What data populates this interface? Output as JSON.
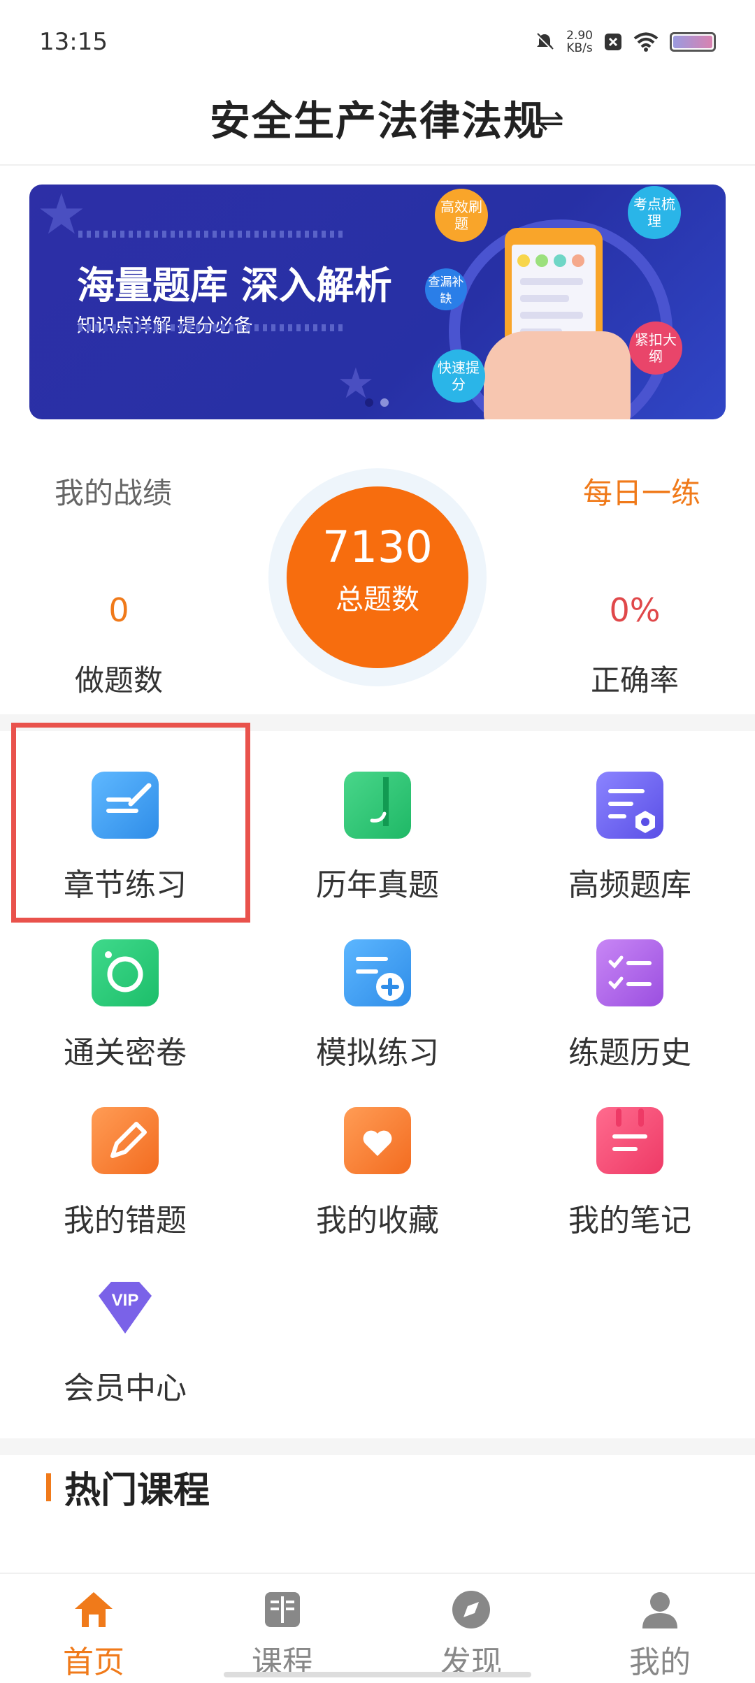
{
  "status": {
    "time": "13:15",
    "speed_value": "2.90",
    "speed_unit": "KB/s"
  },
  "header": {
    "title": "安全生产法律法规",
    "switch_icon": "⇌"
  },
  "banner": {
    "headline": "海量题库 深入解析",
    "subline": "知识点详解 提分必备",
    "bubbles": [
      "高效刷题",
      "考点梳理",
      "查漏补缺",
      "快速提分",
      "紧扣大纲"
    ]
  },
  "stats": {
    "title": "我的战绩",
    "daily_link": "每日一练",
    "total_value": "7130",
    "total_label": "总题数",
    "done_value": "0",
    "done_label": "做题数",
    "accuracy_value": "0%",
    "accuracy_label": "正确率"
  },
  "grid": {
    "items": [
      {
        "label": "章节练习",
        "icon": "chapter-practice-icon"
      },
      {
        "label": "历年真题",
        "icon": "past-exams-icon"
      },
      {
        "label": "高频题库",
        "icon": "high-frequency-icon"
      },
      {
        "label": "通关密卷",
        "icon": "secret-paper-icon"
      },
      {
        "label": "模拟练习",
        "icon": "mock-practice-icon"
      },
      {
        "label": "练题历史",
        "icon": "practice-history-icon"
      },
      {
        "label": "我的错题",
        "icon": "my-mistakes-icon"
      },
      {
        "label": "我的收藏",
        "icon": "my-favorites-icon"
      },
      {
        "label": "我的笔记",
        "icon": "my-notes-icon"
      },
      {
        "label": "会员中心",
        "icon": "vip-icon",
        "badge": "VIP"
      }
    ]
  },
  "hot": {
    "title": "热门课程"
  },
  "tabs": [
    {
      "label": "首页",
      "icon": "home-icon",
      "active": true
    },
    {
      "label": "课程",
      "icon": "book-icon",
      "active": false
    },
    {
      "label": "发现",
      "icon": "compass-icon",
      "active": false
    },
    {
      "label": "我的",
      "icon": "user-icon",
      "active": false
    }
  ],
  "colors": {
    "accent": "#f07a1a",
    "orange_circle": "#f76d0e",
    "highlight": "#e9524c",
    "banner": "#2d2fa6",
    "accuracy": "#e0484a"
  }
}
